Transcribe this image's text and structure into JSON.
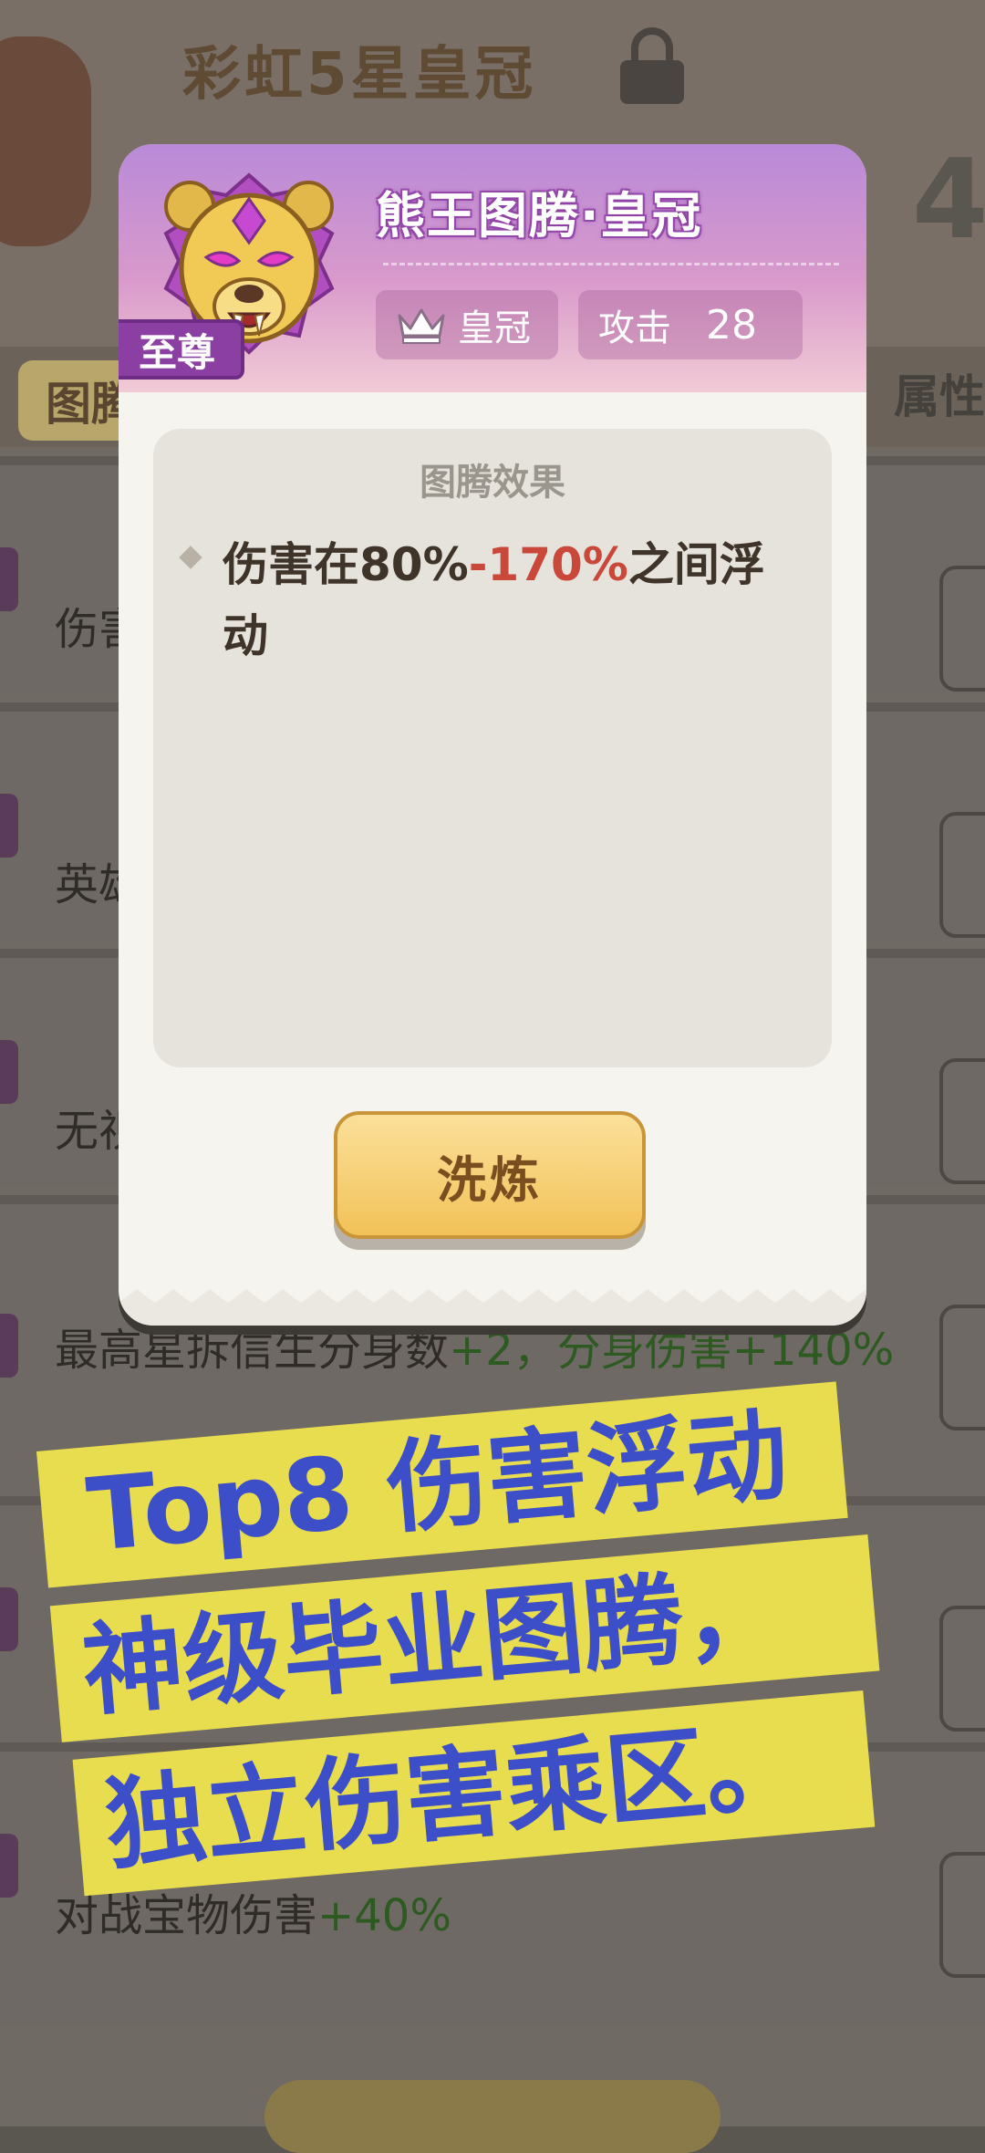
{
  "background": {
    "title": "彩虹5星皇冠",
    "partial_number": "4",
    "tab_left": "图腾",
    "tab_right": "属性",
    "rows": [
      {
        "text": "伤害"
      },
      {
        "text": "英雄"
      },
      {
        "text": "无视"
      },
      {
        "text": "最高星拆信生分身数",
        "bonus": "+2，分身伤害+140%"
      },
      {
        "text": "对战宝物伤害",
        "bonus": "+40%"
      }
    ]
  },
  "modal": {
    "totem_name": "熊王图腾·皇冠",
    "rank_badge": "至尊",
    "crown_chip_label": "皇冠",
    "attack_label": "攻击",
    "attack_value": "28",
    "effect_title": "图腾效果",
    "effect_prefix": "伤害在80%",
    "effect_highlight": "-170%",
    "effect_suffix": "之间浮动",
    "refine_button": "洗炼",
    "colors": {
      "highlight": "#c9483a",
      "header_gradient_top": "#b98ad8",
      "button": "#f2c258"
    }
  },
  "caption": {
    "line1": "Top8 伤害浮动",
    "line2": "神级毕业图腾，",
    "line3": "独立伤害乘区。",
    "colors": {
      "text": "#3d4fc8",
      "highlight": "#e8dc4f"
    }
  }
}
